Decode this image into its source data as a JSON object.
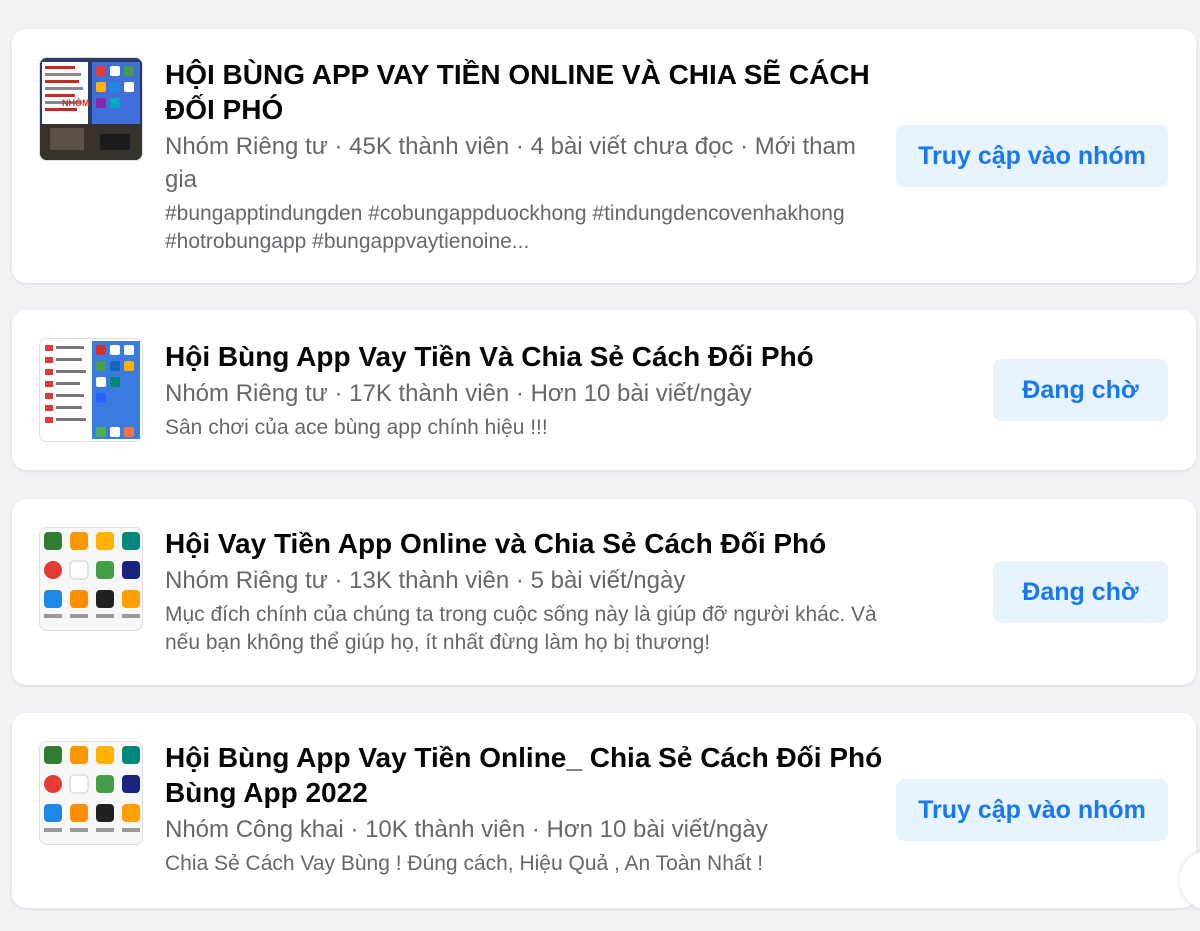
{
  "groups": [
    {
      "title": "HỘI BÙNG APP VAY TIỀN ONLINE VÀ CHIA SẼ CÁCH ĐỐI PHÓ",
      "meta": "Nhóm Riêng tư · 45K thành viên · 4 bài viết chưa đọc · Mới tham gia",
      "description": "#bungapptindungden #cobungappduockhong #tindungdencovenhakhong #hotrobungapp #bungappvaytienoine...",
      "button_label": "Truy cập vào nhóm",
      "thumbnail_icon": "phone-screenshot-thumbnail"
    },
    {
      "title": "Hội Bùng App Vay Tiền Và Chia Sẻ Cách Đối Phó",
      "meta": "Nhóm Riêng tư · 17K thành viên · Hơn 10 bài viết/ngày",
      "description": "Sân chơi của ace bùng app chính hiệu !!!",
      "button_label": "Đang chờ",
      "thumbnail_icon": "phone-screenshot-thumbnail"
    },
    {
      "title": "Hội Vay Tiền App Online và Chia Sẻ Cách Đối Phó",
      "meta": "Nhóm Riêng tư · 13K thành viên · 5 bài viết/ngày",
      "description": "Mục đích chính của chúng ta trong cuộc sống này là giúp đỡ người khác. Và nếu bạn không thể giúp họ, ít nhất đừng làm họ bị thương!",
      "button_label": "Đang chờ",
      "thumbnail_icon": "app-grid-thumbnail"
    },
    {
      "title": "Hội Bùng App Vay Tiền Online_ Chia Sẻ Cách Đối Phó Bùng App 2022",
      "meta": "Nhóm Công khai · 10K thành viên · Hơn 10 bài viết/ngày",
      "description": "Chia Sẻ Cách Vay Bùng ! Đúng cách, Hiệu Quả , An Toàn Nhất !",
      "button_label": "Truy cập vào nhóm",
      "thumbnail_icon": "app-grid-thumbnail"
    }
  ],
  "colors": {
    "background": "#f0f2f5",
    "card": "#ffffff",
    "title": "#050505",
    "secondary_text": "#65676b",
    "button_bg": "#e7f3ff",
    "button_text": "#1877f2"
  }
}
